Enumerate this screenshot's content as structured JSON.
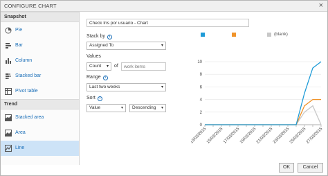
{
  "window": {
    "title": "CONFIGURE CHART",
    "close_glyph": "×"
  },
  "sidebar": {
    "sections": [
      {
        "header": "Snapshot",
        "items": [
          {
            "label": "Pie",
            "icon": "pie-chart-icon"
          },
          {
            "label": "Bar",
            "icon": "bar-chart-icon"
          },
          {
            "label": "Column",
            "icon": "column-chart-icon"
          },
          {
            "label": "Stacked bar",
            "icon": "stacked-bar-icon"
          },
          {
            "label": "Pivot table",
            "icon": "pivot-table-icon"
          }
        ]
      },
      {
        "header": "Trend",
        "items": [
          {
            "label": "Stacked area",
            "icon": "stacked-area-icon"
          },
          {
            "label": "Area",
            "icon": "area-chart-icon"
          },
          {
            "label": "Line",
            "icon": "line-chart-icon",
            "selected": true
          }
        ]
      }
    ]
  },
  "form": {
    "chart_title_value": "Check Ins por usuario - Chart",
    "stack_by_label": "Stack by",
    "stack_by_value": "Assigned To",
    "values_label": "Values",
    "values_agg": "Count",
    "values_of": "of",
    "values_field_placeholder": "work items",
    "range_label": "Range",
    "range_value": "Last two weeks",
    "sort_label": "Sort",
    "sort_field": "Value",
    "sort_direction": "Descending",
    "info_glyph": "i",
    "dropdown_glyph": "▾"
  },
  "legend": [
    {
      "label": "",
      "color": "#1e9bd7"
    },
    {
      "label": "",
      "color": "#f0932a"
    },
    {
      "label": "(blank)",
      "color": "#c8c8c8"
    }
  ],
  "chart_data": {
    "type": "line",
    "x": [
      "13/03/2015",
      "14/03/2015",
      "15/03/2015",
      "16/03/2015",
      "17/03/2015",
      "18/03/2015",
      "19/03/2015",
      "20/03/2015",
      "21/03/2015",
      "22/03/2015",
      "23/03/2015",
      "24/03/2015",
      "25/03/2015",
      "26/03/2015",
      "27/03/2015"
    ],
    "x_tick_labels": [
      "13/03/2015",
      "15/03/2015",
      "17/03/2015",
      "19/03/2015",
      "21/03/2015",
      "23/03/2015",
      "25/03/2015",
      "27/03/2015"
    ],
    "ylim": [
      0,
      10
    ],
    "y_ticks": [
      0,
      2,
      4,
      6,
      8,
      10
    ],
    "series": [
      {
        "color": "#1e9bd7",
        "values": [
          0,
          0,
          0,
          0,
          0,
          0,
          0,
          0,
          0,
          0,
          0,
          0,
          5,
          9,
          10
        ]
      },
      {
        "color": "#f0932a",
        "values": [
          0,
          0,
          0,
          0,
          0,
          0,
          0,
          0,
          0,
          0,
          0,
          0,
          3,
          4,
          4
        ]
      },
      {
        "label": "(blank)",
        "color": "#c8c8c8",
        "values": [
          0,
          0,
          0,
          0,
          0,
          0,
          0,
          0,
          0,
          0,
          0,
          0,
          2,
          3,
          0
        ]
      }
    ]
  },
  "footer": {
    "ok_label": "OK",
    "cancel_label": "Cancel"
  }
}
